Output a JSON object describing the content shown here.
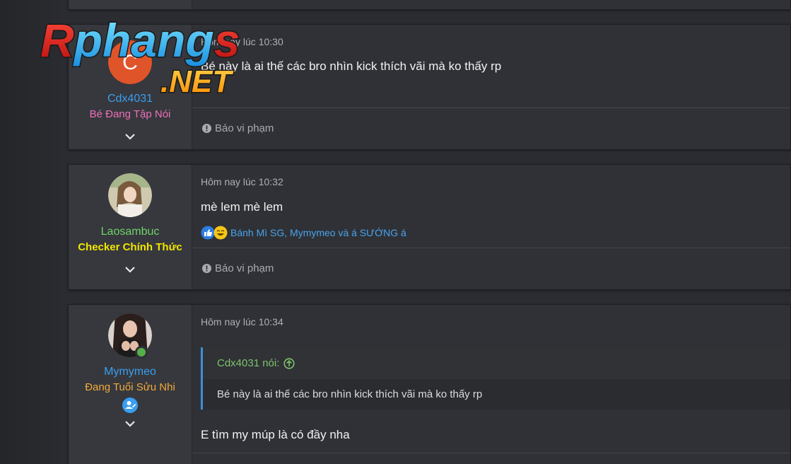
{
  "posts": [
    {
      "avatar_letter": "C",
      "avatar_color": "#e0542a",
      "username": "Cdx4031",
      "username_color": "#3a9ef0",
      "user_title": "Bé Đang Tập Nói",
      "user_title_color": "#ee6fb8",
      "time": "Hôm nay lúc 10:30",
      "message": "Bé này là ai thế các bro nhìn kick thích vãi mà ko thấy rp",
      "report_label": "Báo vi phạm"
    },
    {
      "username": "Laosambuc",
      "username_color": "#6fd36a",
      "user_title": "Checker Chính Thức",
      "user_title_color": "#f2e600",
      "time": "Hôm nay lúc 10:32",
      "message": "mè lem mè lem",
      "reactions_text": "Bánh Mì SG, Mymymeo và á SƯỚNG á",
      "report_label": "Báo vi phạm"
    },
    {
      "username": "Mymymeo",
      "username_color": "#3a9ef0",
      "user_title": "Đang Tuổi Sửu Nhi",
      "user_title_color": "#f2a93b",
      "time": "Hôm nay lúc 10:34",
      "quote_author": "Cdx4031 nói:",
      "quote_text": "Bé này là ai thế các bro nhìn kick thích vãi mà ko thấy rp",
      "message": "E tìm my múp là có đầy nha"
    }
  ],
  "logo": {
    "line1": "Rphangs",
    "line2": ".NET"
  },
  "colors": {
    "accent_blue": "#3a9ef0",
    "quote_border": "#3d8fd6"
  }
}
